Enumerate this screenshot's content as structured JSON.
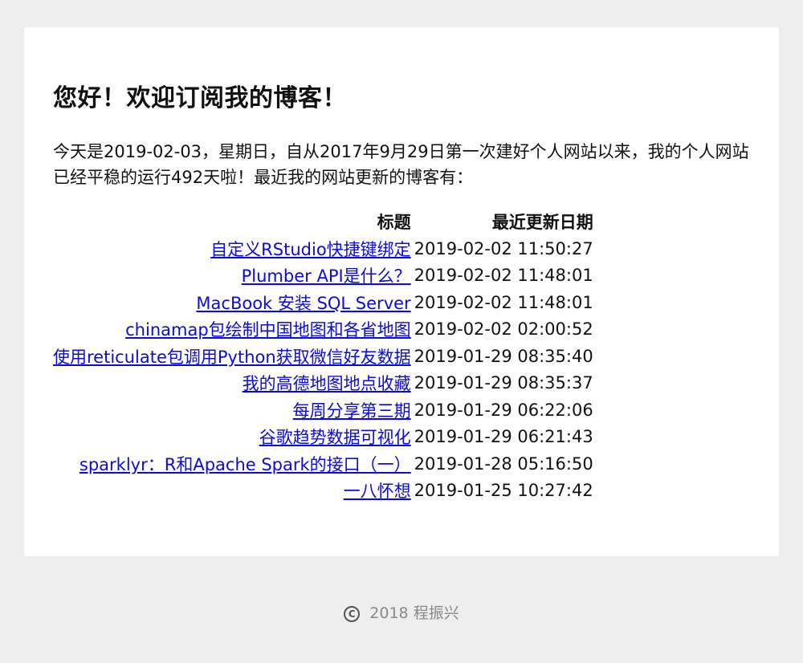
{
  "heading": "您好！欢迎订阅我的博客！",
  "intro": "今天是2019-02-03，星期日，自从2017年9月29日第一次建好个人网站以来，我的个人网站已经平稳的运行492天啦！最近我的网站更新的博客有：",
  "table": {
    "headers": [
      "标题",
      "最近更新日期"
    ],
    "rows": [
      {
        "title": "自定义RStudio快捷键绑定",
        "date": "2019-02-02 11:50:27"
      },
      {
        "title": "Plumber API是什么？",
        "date": "2019-02-02 11:48:01"
      },
      {
        "title": "MacBook 安装 SQL Server",
        "date": "2019-02-02 11:48:01"
      },
      {
        "title": "chinamap包绘制中国地图和各省地图",
        "date": "2019-02-02 02:00:52"
      },
      {
        "title": "使用reticulate包调用Python获取微信好友数据",
        "date": "2019-01-29 08:35:40"
      },
      {
        "title": "我的高德地图地点收藏",
        "date": "2019-01-29 08:35:37"
      },
      {
        "title": "每周分享第三期",
        "date": "2019-01-29 06:22:06"
      },
      {
        "title": "谷歌趋势数据可视化",
        "date": "2019-01-29 06:21:43"
      },
      {
        "title": "sparklyr：R和Apache Spark的接口（一）",
        "date": "2019-01-28 05:16:50"
      },
      {
        "title": "一八怀想",
        "date": "2019-01-25 10:27:42"
      }
    ]
  },
  "footer": {
    "icon": "copyright-icon",
    "text": "2018 程振兴"
  },
  "colors": {
    "link": "#0b0bd9",
    "background": "#eeeeee",
    "card": "#ffffff",
    "footer_text": "#888888"
  }
}
